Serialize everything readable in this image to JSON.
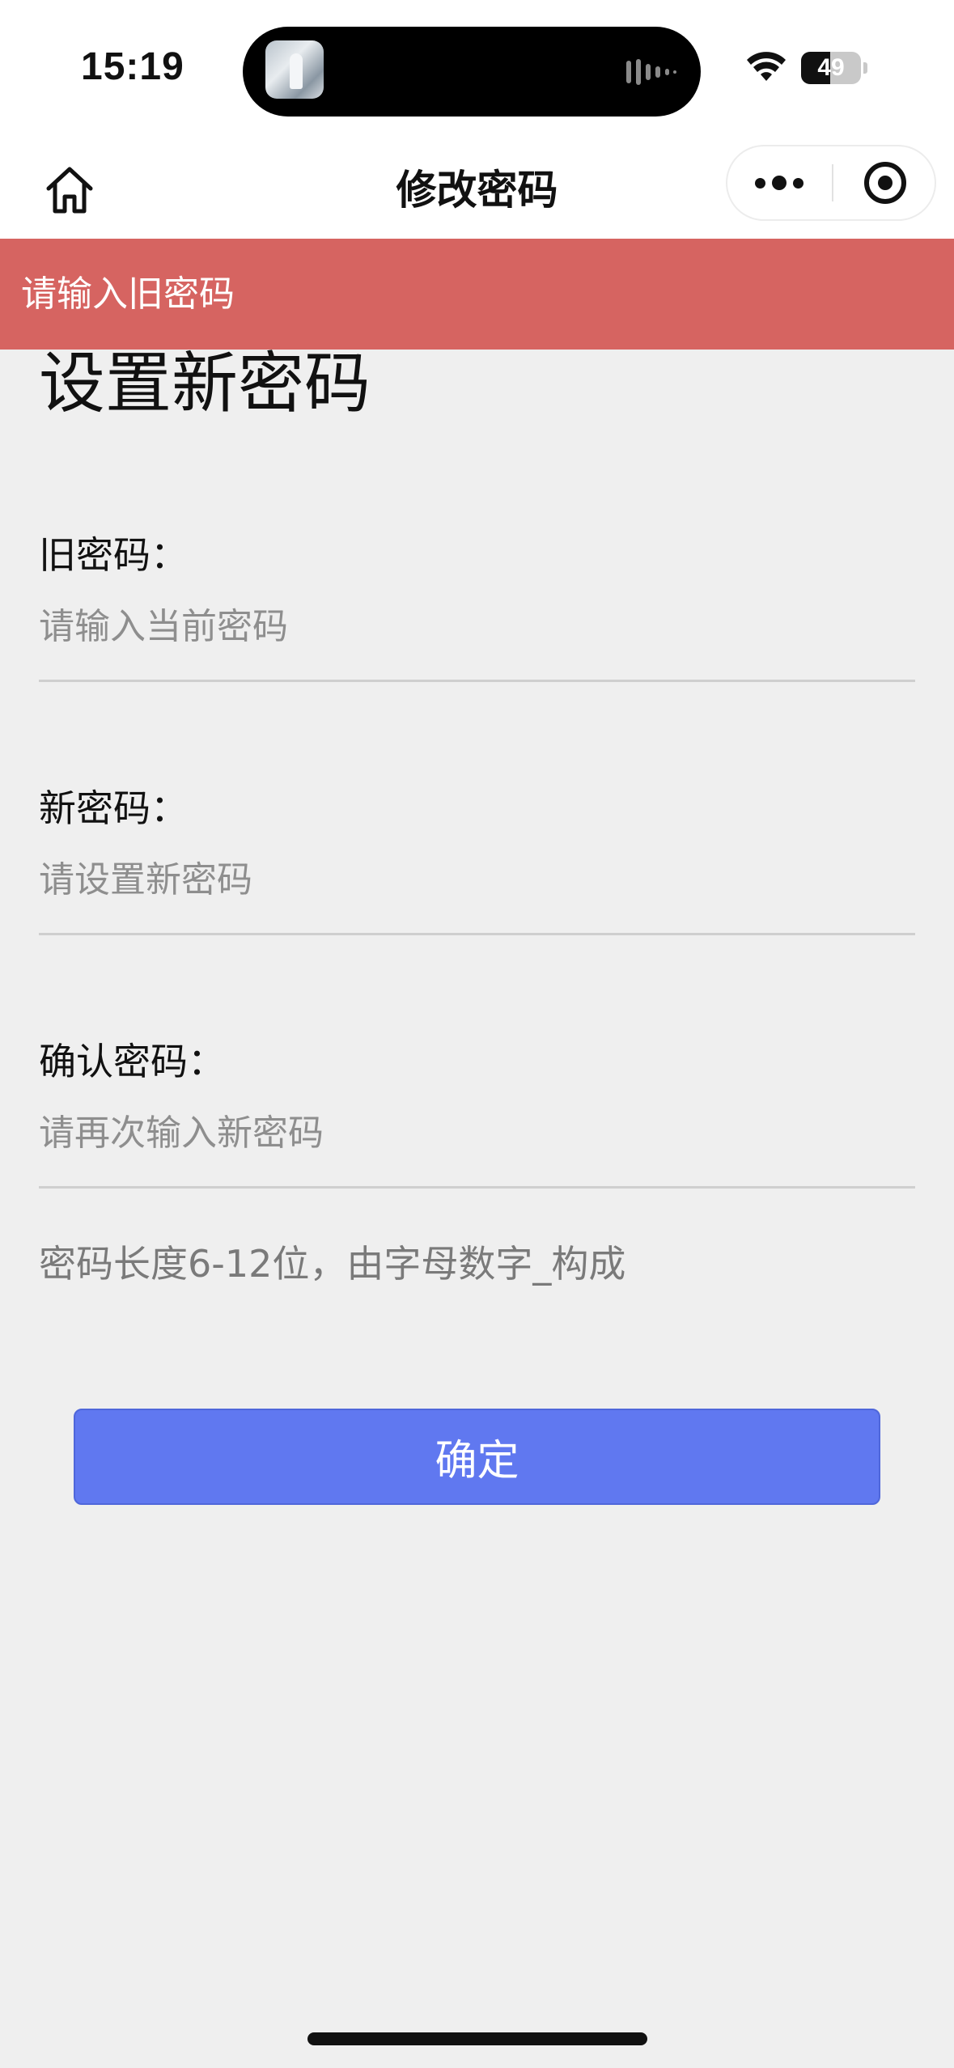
{
  "status_bar": {
    "time": "15:19",
    "battery_level": "49",
    "battery_fraction": 0.49,
    "icons": [
      "now-playing-artwork",
      "audio-waveform-icon",
      "wifi-icon",
      "battery-icon"
    ]
  },
  "nav": {
    "title": "修改密码",
    "home_icon": "home-icon",
    "more_icon": "more-dots-icon",
    "close_icon": "target-close-icon"
  },
  "error_toast": {
    "message": "请输入旧密码",
    "color": "#d66461"
  },
  "form": {
    "heading": "设置新密码",
    "fields": [
      {
        "label": "旧密码：",
        "placeholder": "请输入当前密码",
        "value": ""
      },
      {
        "label": "新密码：",
        "placeholder": "请设置新密码",
        "value": ""
      },
      {
        "label": "确认密码：",
        "placeholder": "请再次输入新密码",
        "value": ""
      }
    ],
    "hint": "密码长度6-12位，由字母数字_构成",
    "submit_label": "确定",
    "submit_color": "#6078f0"
  },
  "background_color": "#efefef"
}
